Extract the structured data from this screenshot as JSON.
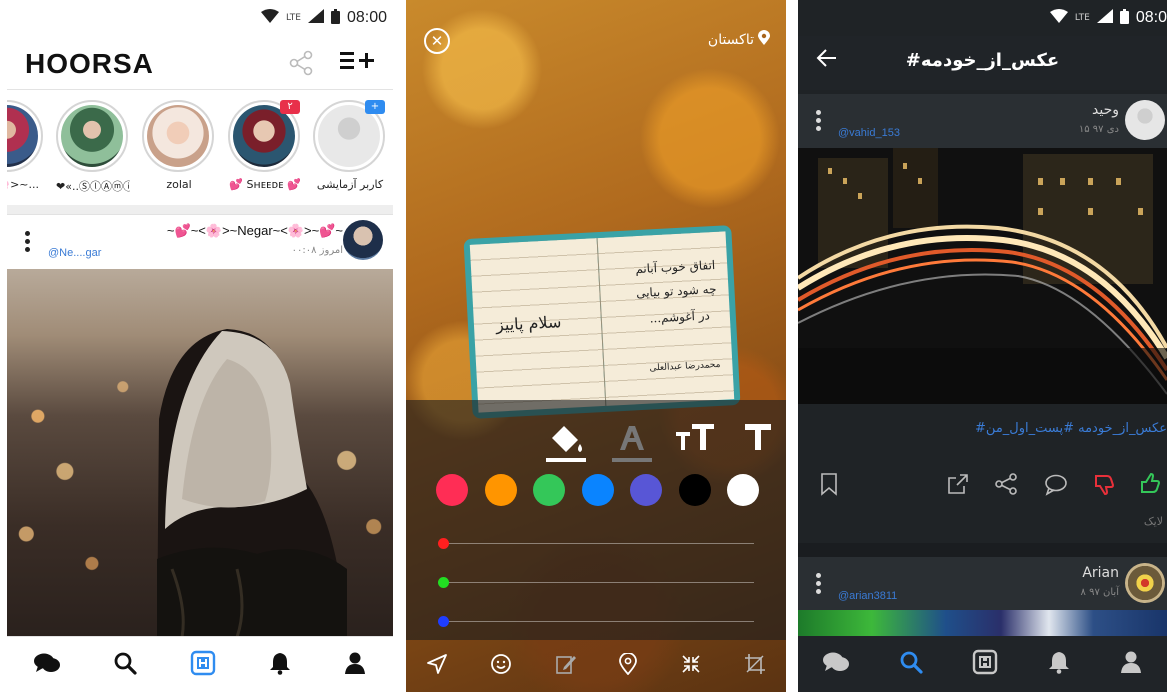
{
  "screen1": {
    "status": {
      "time": "08:00",
      "network": "LTE"
    },
    "logo": "HOORSA",
    "stories": [
      {
        "name": "کاربر آزمایشی",
        "badge": "+",
        "badge_color": "#2f8cf0",
        "placeholder": true
      },
      {
        "name": "💕 Sʜᴇᴇᴅᴇ 💕",
        "badge": "۲",
        "badge_color": "#e8304a"
      },
      {
        "name": "zolal"
      },
      {
        "name": "❤«..ⓈⓛⒶⓜⓘ.."
      },
      {
        "name": "🌸>~..."
      }
    ],
    "post": {
      "author": "~💕~<🌸>~Negar~<🌸>~💕~",
      "time": "امروز ۰۰:۰۸",
      "handle": "@Ne....gar"
    }
  },
  "screen2": {
    "location": "تاکستان",
    "notebook": {
      "left_text": "سلام پاییز",
      "right_lines": [
        "اتفاق خوب آبانم",
        "چه شود تو بیایی",
        "در آغوشم...",
        "محمدرضا عبدالعلی"
      ]
    },
    "colors": [
      "#ff2d55",
      "#ff9500",
      "#34c759",
      "#0a84ff",
      "#5856d6",
      "#000000",
      "#ffffff"
    ],
    "sliders": [
      {
        "color": "#ff1f1f",
        "value": 0
      },
      {
        "color": "#22dd22",
        "value": 0
      },
      {
        "color": "#1f3dff",
        "value": 0
      }
    ]
  },
  "screen3": {
    "status": {
      "time": "08:0",
      "network": "LTE"
    },
    "title": "#عکس_از_خودمه",
    "post1": {
      "author": "وحید",
      "time": "۱۵ دی ۹۷",
      "handle": "@vahid_153",
      "tags": "#عکس_از_خودمه #پست_اول_من",
      "likes_label": "لایک"
    },
    "post2": {
      "author": "Arian",
      "time": "۸ آبان ۹۷",
      "handle": "@arian3811"
    }
  },
  "accent": "#2f8cf0"
}
